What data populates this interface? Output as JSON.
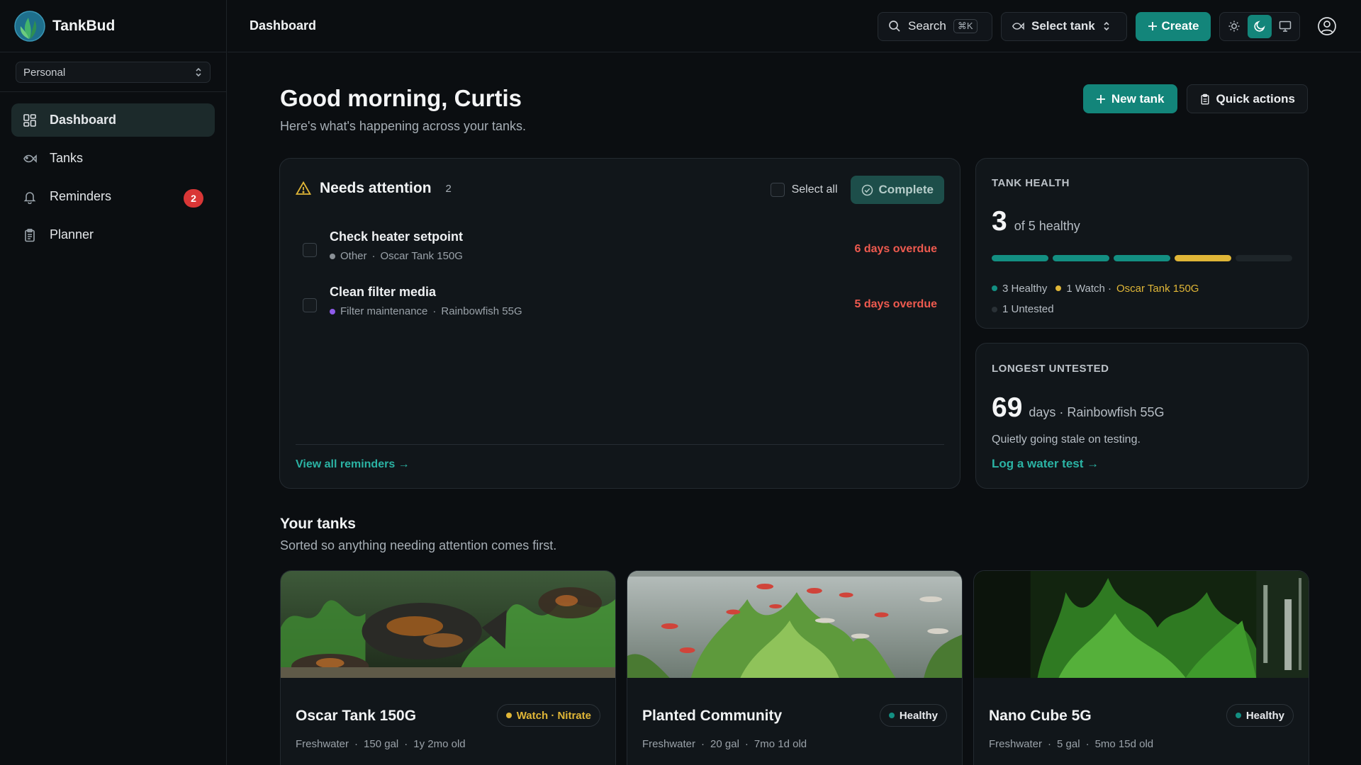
{
  "app": {
    "name": "TankBud"
  },
  "sidebar": {
    "workspace": "Personal",
    "items": [
      {
        "label": "Dashboard",
        "icon": "dashboard-icon",
        "active": true
      },
      {
        "label": "Tanks",
        "icon": "fish-icon"
      },
      {
        "label": "Reminders",
        "icon": "bell-icon",
        "badge": "2"
      },
      {
        "label": "Planner",
        "icon": "clipboard-icon"
      }
    ]
  },
  "topbar": {
    "title": "Dashboard",
    "search_label": "Search",
    "search_shortcut": "⌘K",
    "tank_select_label": "Select tank",
    "create_label": "Create",
    "theme_active": "dark"
  },
  "header": {
    "greeting": "Good morning, Curtis",
    "subtitle": "Here's what's happening across your tanks.",
    "new_tank_label": "New tank",
    "quick_actions_label": "Quick actions"
  },
  "attention": {
    "title": "Needs attention",
    "count": "2",
    "select_all_label": "Select all",
    "complete_label": "Complete",
    "tasks": [
      {
        "title": "Check heater setpoint",
        "category": "Other",
        "category_color": "#8a9096",
        "tank": "Oscar Tank 150G",
        "due": "6 days overdue"
      },
      {
        "title": "Clean filter media",
        "category": "Filter maintenance",
        "category_color": "#8e5bea",
        "tank": "Rainbowfish 55G",
        "due": "5 days overdue"
      }
    ],
    "view_all_label": "View all reminders →"
  },
  "health": {
    "label": "Tank health",
    "healthy_count": "3",
    "of_total": "of 5 healthy",
    "segments": [
      "healthy",
      "healthy",
      "healthy",
      "watch",
      "untested"
    ],
    "legend_healthy": "3 Healthy",
    "legend_watch": "1 Watch ·",
    "legend_watch_tank": "Oscar Tank 150G",
    "legend_untested": "1 Untested",
    "colors": {
      "healthy": "#138f82",
      "watch": "#e0b637"
    }
  },
  "untested": {
    "label": "Longest untested",
    "days": "69",
    "detail": "days · Rainbowfish 55G",
    "note": "Quietly going stale on testing.",
    "link": "Log a water test →"
  },
  "tanks": {
    "title": "Your tanks",
    "subtitle": "Sorted so anything needing attention comes first.",
    "items": [
      {
        "name": "Oscar Tank 150G",
        "status": "Watch · Nitrate",
        "status_kind": "watch",
        "type": "Freshwater",
        "volume": "150 gal",
        "age": "1y 2mo old"
      },
      {
        "name": "Planted Community",
        "status": "Healthy",
        "status_kind": "healthy",
        "type": "Freshwater",
        "volume": "20 gal",
        "age": "7mo 1d old"
      },
      {
        "name": "Nano Cube 5G",
        "status": "Healthy",
        "status_kind": "healthy",
        "type": "Freshwater",
        "volume": "5 gal",
        "age": "5mo 15d old"
      }
    ]
  }
}
